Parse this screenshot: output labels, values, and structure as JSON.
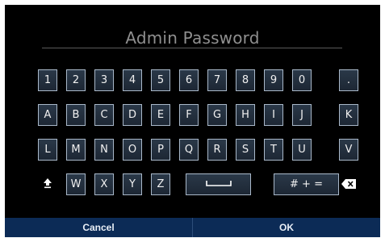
{
  "title": "Admin Password",
  "rows": [
    [
      "1",
      "2",
      "3",
      "4",
      "5",
      "6",
      "7",
      "8",
      "9",
      "0",
      "."
    ],
    [
      "A",
      "B",
      "C",
      "D",
      "E",
      "F",
      "G",
      "H",
      "I",
      "J",
      "K"
    ],
    [
      "L",
      "M",
      "N",
      "O",
      "P",
      "Q",
      "R",
      "S",
      "T",
      "U",
      "V"
    ],
    [
      "W",
      "X",
      "Y",
      "Z"
    ]
  ],
  "symbols_label": "# + =",
  "icons": {
    "shift": "shift-up-arrow-icon",
    "space": "space-bar-icon",
    "backspace": "backspace-icon"
  },
  "buttons": {
    "cancel": "Cancel",
    "ok": "OK"
  },
  "colors": {
    "background": "#000000",
    "key_border": "#a9b8c9",
    "bottom_bar": "#0c2b56"
  }
}
